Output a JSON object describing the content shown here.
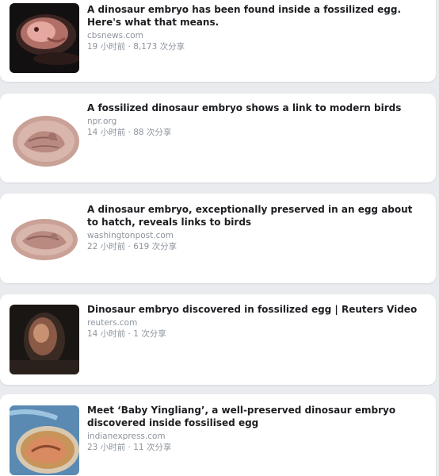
{
  "articles": [
    {
      "title": "A dinosaur embryo has been found inside a fossilized egg. Here's what that means.",
      "domain": "cbsnews.com",
      "meta": "19 小时前 · 8,173 次分享",
      "thumbnail": "embryo-egg-dark"
    },
    {
      "title": "A fossilized dinosaur embryo shows a link to modern birds",
      "domain": "npr.org",
      "meta": "14 小时前 · 88 次分享",
      "thumbnail": "fossil-embryo-illustration"
    },
    {
      "title": "A dinosaur embryo, exceptionally preserved in an egg about to hatch, reveals links to birds",
      "domain": "washingtonpost.com",
      "meta": "22 小时前 · 619 次分享",
      "thumbnail": "fossil-embryo-illustration"
    },
    {
      "title": "Dinosaur embryo discovered in fossilized egg | Reuters Video",
      "domain": "reuters.com",
      "meta": "14 小时前 · 1 次分享",
      "thumbnail": "glowing-egg-dark"
    },
    {
      "title": "Meet ‘Baby Yingliang’, a well-preserved dinosaur embryo discovered inside fossilised egg",
      "domain": "indianexpress.com",
      "meta": "23 小时前 · 11 次分享",
      "thumbnail": "embryo-blue-egg"
    }
  ]
}
